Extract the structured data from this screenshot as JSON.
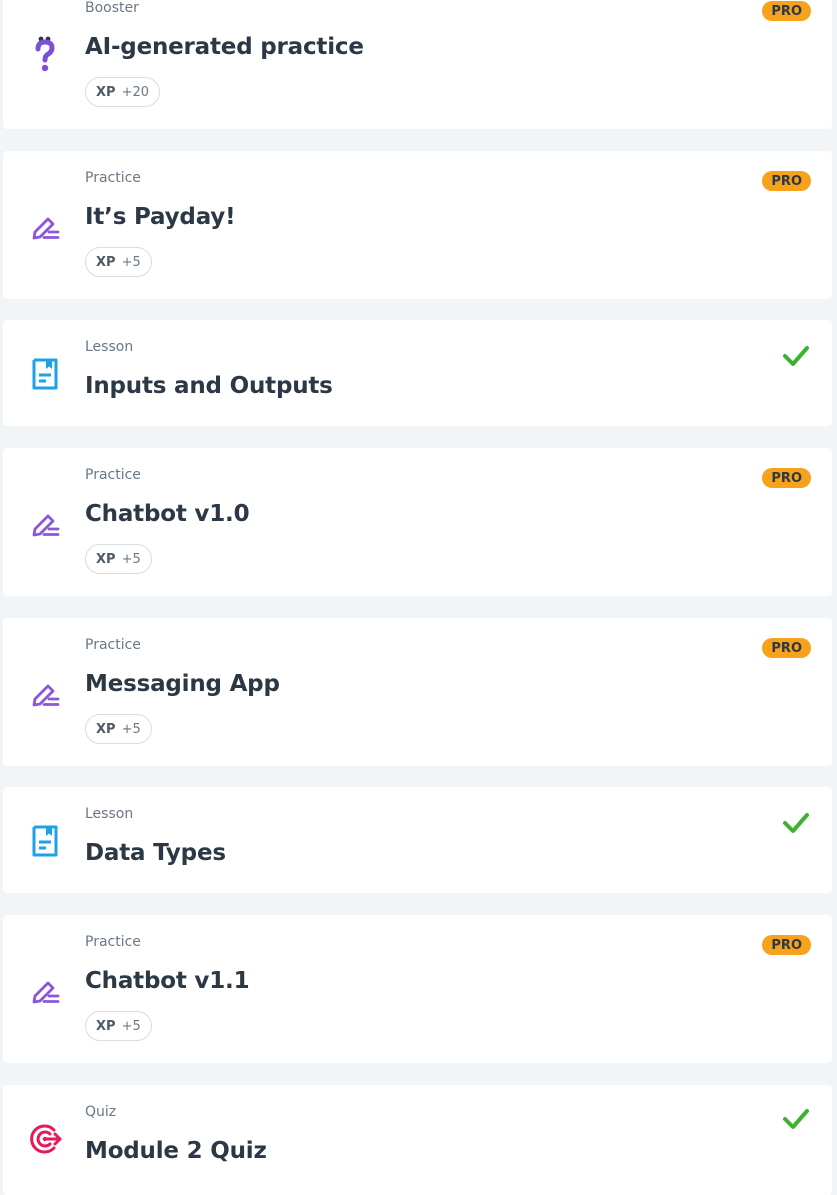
{
  "cards": [
    {
      "kind": "booster",
      "type": "Booster",
      "title": "AI-generated practice",
      "xp_label": "XP",
      "xp_value": "+20",
      "badge": "PRO"
    },
    {
      "kind": "practice",
      "type": "Practice",
      "title": "It’s Payday!",
      "xp_label": "XP",
      "xp_value": "+5",
      "badge": "PRO"
    },
    {
      "kind": "lesson",
      "type": "Lesson",
      "title": "Inputs and Outputs",
      "status": "completed"
    },
    {
      "kind": "practice",
      "type": "Practice",
      "title": "Chatbot v1.0",
      "xp_label": "XP",
      "xp_value": "+5",
      "badge": "PRO"
    },
    {
      "kind": "practice",
      "type": "Practice",
      "title": "Messaging App",
      "xp_label": "XP",
      "xp_value": "+5",
      "badge": "PRO"
    },
    {
      "kind": "lesson",
      "type": "Lesson",
      "title": "Data Types",
      "status": "completed"
    },
    {
      "kind": "practice",
      "type": "Practice",
      "title": "Chatbot v1.1",
      "xp_label": "XP",
      "xp_value": "+5",
      "badge": "PRO"
    },
    {
      "kind": "quiz",
      "type": "Quiz",
      "title": "Module 2 Quiz",
      "status": "completed"
    }
  ],
  "icons": {
    "booster": "question-mark-icon",
    "practice": "pencil-icon",
    "lesson": "lesson-document-icon",
    "quiz": "target-icon",
    "completed": "checkmark-icon"
  },
  "colors": {
    "booster_icon": "#7b4fd6",
    "practice_icon": "#8b56dc",
    "lesson_icon": "#1da1e8",
    "quiz_icon": "#e6195a",
    "check": "#3fb131",
    "pro_badge": "#f7a21b"
  }
}
